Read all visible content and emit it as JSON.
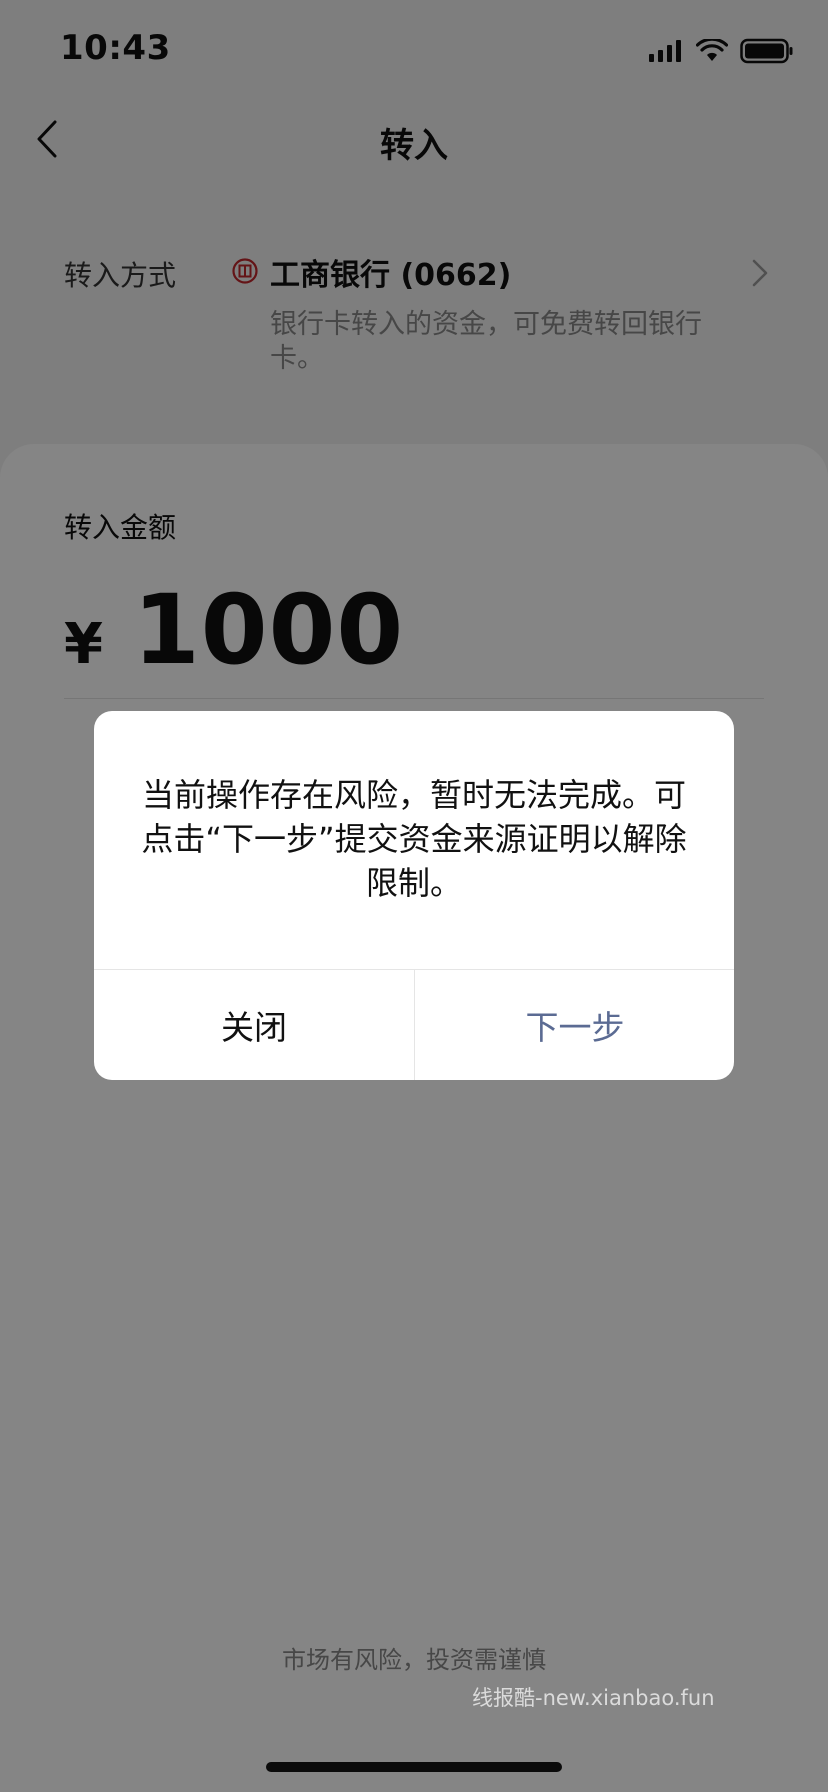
{
  "status_bar": {
    "time": "10:43"
  },
  "nav": {
    "title": "转入"
  },
  "method": {
    "label": "转入方式",
    "bank_name": "工商银行 (0662)",
    "note": "银行卡转入的资金，可免费转回银行卡。",
    "bank_color": "#c0272d"
  },
  "amount": {
    "label": "转入金额",
    "currency": "¥",
    "value": "1000"
  },
  "footer": {
    "disclaimer": "市场有风险，投资需谨慎"
  },
  "dialog": {
    "message": "当前操作存在风险，暂时无法完成。可点击“下一步”提交资金来源证明以解除限制。",
    "close_label": "关闭",
    "next_label": "下一步",
    "next_color": "#5b6b93"
  },
  "watermark": "线报酷-new.xianbao.fun",
  "icons": {
    "back": "chevron-left-icon",
    "chevron": "chevron-right-icon",
    "bank": "icbc-logo-icon",
    "signal": "signal-icon",
    "wifi": "wifi-icon",
    "battery": "battery-icon"
  }
}
